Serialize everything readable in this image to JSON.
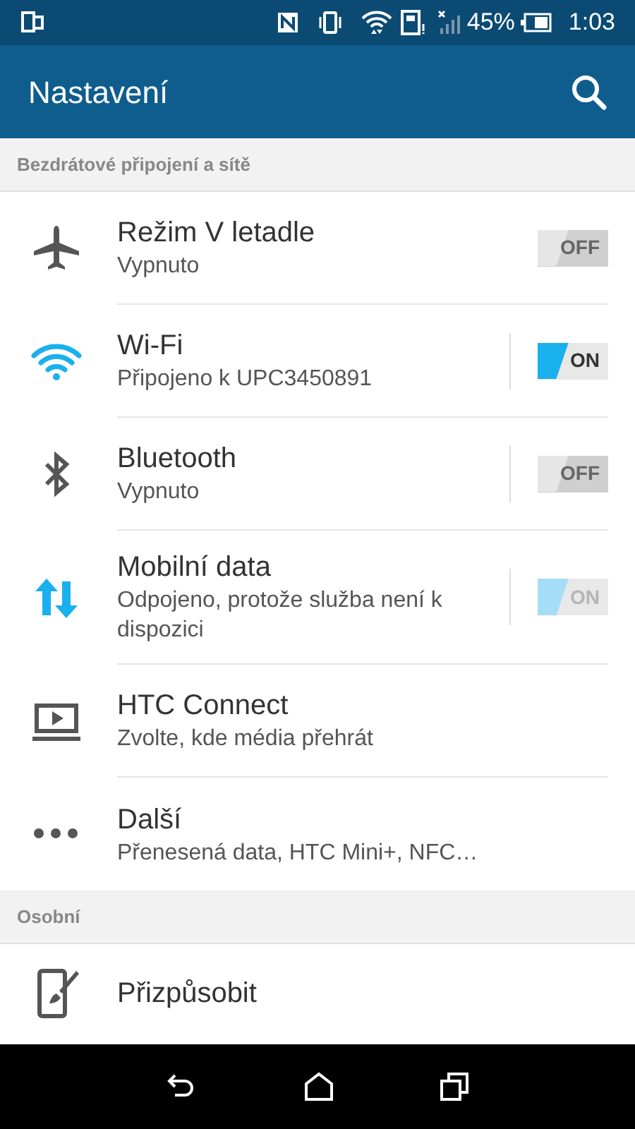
{
  "status_bar": {
    "battery": "45%",
    "time": "1:03"
  },
  "app_bar": {
    "title": "Nastavení"
  },
  "sections": [
    {
      "header": "Bezdrátové připojení a sítě",
      "items": [
        {
          "kind": "toggle",
          "title": "Režim V letadle",
          "subtitle": "Vypnuto",
          "on": false,
          "disabled": false,
          "split": false,
          "switch_text": "OFF"
        },
        {
          "kind": "toggle",
          "title": "Wi-Fi",
          "subtitle": "Připojeno k UPC3450891",
          "on": true,
          "disabled": false,
          "split": true,
          "switch_text": "ON"
        },
        {
          "kind": "toggle",
          "title": "Bluetooth",
          "subtitle": "Vypnuto",
          "on": false,
          "disabled": false,
          "split": true,
          "switch_text": "OFF"
        },
        {
          "kind": "toggle",
          "title": "Mobilní data",
          "subtitle": "Odpojeno, protože služba není k dispozici",
          "on": true,
          "disabled": true,
          "split": true,
          "switch_text": "ON"
        },
        {
          "kind": "plain",
          "title": "HTC Connect",
          "subtitle": "Zvolte, kde média přehrát"
        },
        {
          "kind": "plain",
          "title": "Další",
          "subtitle": "Přenesená data, HTC Mini+, NFC…"
        }
      ]
    },
    {
      "header": "Osobní",
      "items": [
        {
          "kind": "plain",
          "title": "Přizpůsobit"
        }
      ]
    }
  ]
}
